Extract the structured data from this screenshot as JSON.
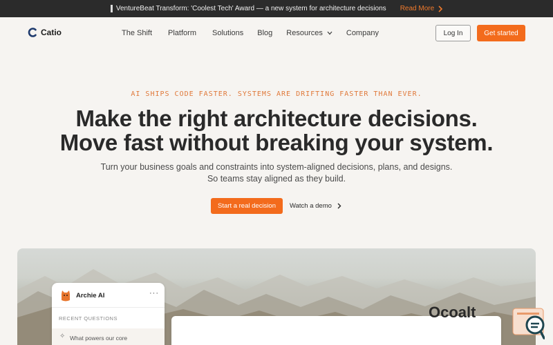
{
  "announcement": {
    "text": "VentureBeat Transform: 'Coolest Tech' Award — a new system for architecture decisions",
    "read_more": "Read More"
  },
  "brand": {
    "name": "Catio",
    "accent": "#f36b1c"
  },
  "nav": {
    "links": [
      "The Shift",
      "Platform",
      "Solutions",
      "Blog",
      "Resources",
      "Company"
    ],
    "login": "Log In",
    "get_started": "Get started"
  },
  "hero": {
    "eyebrow": "AI SHIPS CODE FASTER. SYSTEMS ARE DRIFTING FASTER THAN EVER.",
    "headline_line1": "Make the right architecture decisions.",
    "headline_line2": "Move fast without breaking your system.",
    "sub_line1": "Turn your business goals and constraints into system-aligned decisions, plans, and designs.",
    "sub_line2": "So teams stay aligned as they build.",
    "cta_primary": "Start a real decision",
    "cta_secondary": "Watch a demo"
  },
  "chat": {
    "title": "Archie AI",
    "more": "···",
    "section": "RECENT QUESTIONS",
    "item": "What powers our core"
  },
  "preview": {
    "text": "Ocoalt"
  },
  "icons": {
    "logo": "catio-logo-icon",
    "readmore": "chevron-right-icon",
    "resources": "chevron-down-icon",
    "demo": "chevron-right-icon",
    "avatar": "cat-avatar-icon",
    "sparkle": "sparkle-icon",
    "widget": "search-chat-icon"
  }
}
